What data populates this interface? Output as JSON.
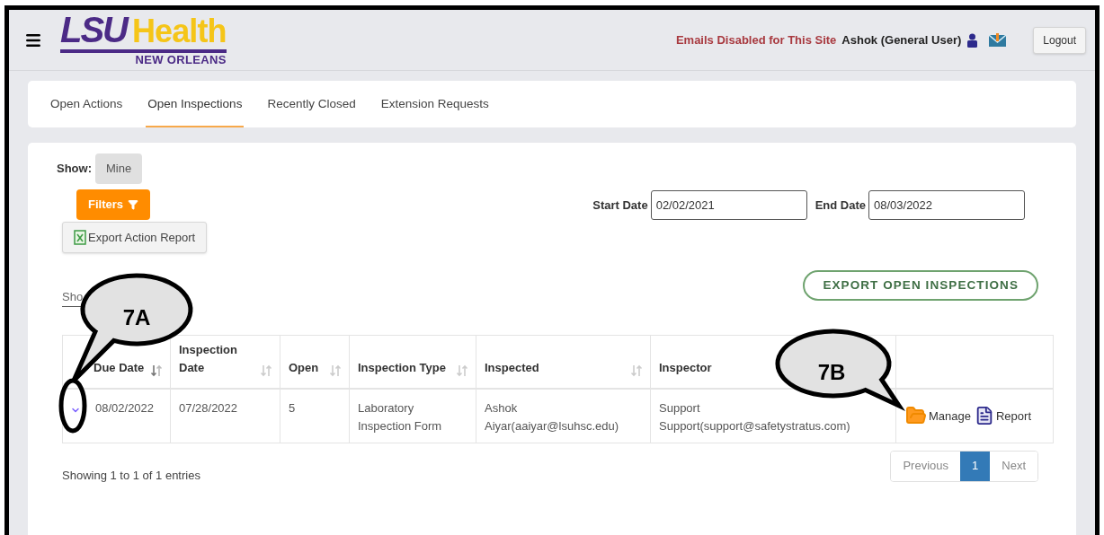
{
  "header": {
    "logo": {
      "primary": "LSU",
      "secondary": "Health",
      "tagline": "NEW ORLEANS"
    },
    "notice": "Emails Disabled for This Site",
    "user": "Ashok (General User)",
    "logout": "Logout"
  },
  "tabs": [
    {
      "label": "Open Actions",
      "selected": false
    },
    {
      "label": "Open Inspections",
      "selected": true
    },
    {
      "label": "Recently Closed",
      "selected": false
    },
    {
      "label": "Extension Requests",
      "selected": false
    }
  ],
  "controls": {
    "show_label": "Show:",
    "show_option": "Mine",
    "filters_button": "Filters",
    "export_action_report": "Export Action Report",
    "start_date_label": "Start Date",
    "start_date": "02/02/2021",
    "end_date_label": "End Date",
    "end_date": "08/03/2022",
    "export_open": "EXPORT OPEN INSPECTIONS",
    "length_label": "Sho"
  },
  "table": {
    "columns": [
      {
        "label": "Due Date",
        "sortable": true,
        "sorted": true
      },
      {
        "label": "Inspection Date",
        "sortable": true,
        "sorted": false
      },
      {
        "label": "Open",
        "sortable": true,
        "sorted": false
      },
      {
        "label": "Inspection Type",
        "sortable": true,
        "sorted": false
      },
      {
        "label": "Inspected",
        "sortable": true,
        "sorted": false
      },
      {
        "label": "Inspector"
      },
      {
        "sortable": false,
        "sorted": false
      }
    ],
    "rows": [
      {
        "expanded": false,
        "cells": [
          [
            "08/02/2022"
          ],
          [
            "07/28/2022"
          ],
          [
            "5"
          ],
          [
            "Laboratory",
            "Inspection Form"
          ],
          [
            "Ashok",
            "Aiyar(aaiyar@lsuhsc.edu)"
          ],
          [
            "Support",
            "Support(support@safetystratus.com)"
          ]
        ],
        "actions": [
          "Manage",
          "Report"
        ]
      }
    ]
  },
  "info": "Showing 1 to 1 of 1 entries",
  "pagination": [
    {
      "label": "Previous",
      "selected": false,
      "disabled": true
    },
    {
      "label": "1",
      "selected": true,
      "disabled": false
    },
    {
      "label": "Next",
      "selected": false,
      "disabled": true
    }
  ],
  "callouts": [
    {
      "label": "7A"
    },
    {
      "label": "7B"
    }
  ]
}
